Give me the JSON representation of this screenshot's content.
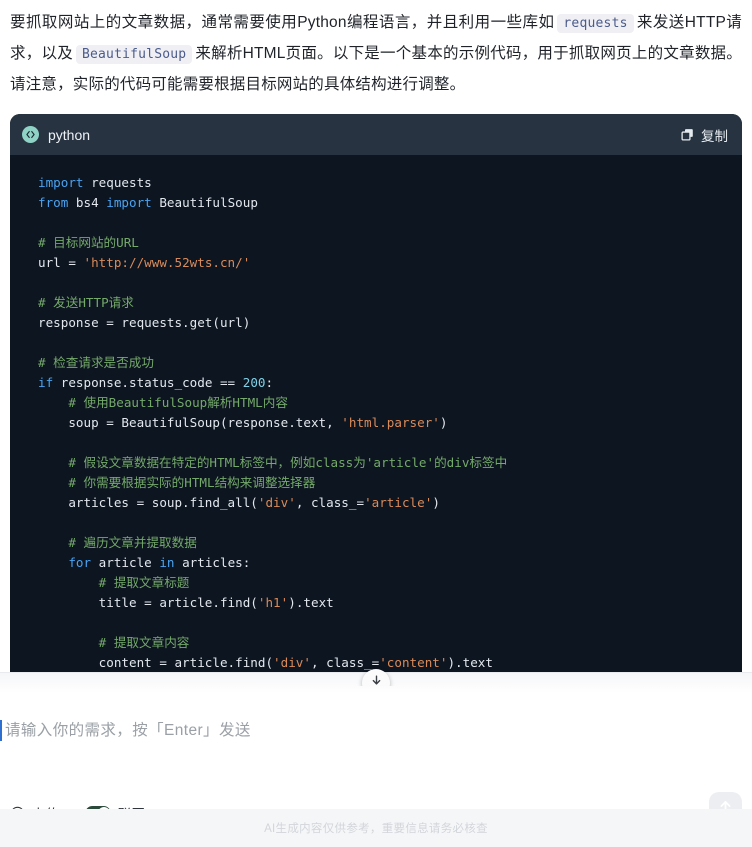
{
  "message": {
    "paragraph_parts": [
      {
        "type": "text",
        "value": "要抓取网站上的文章数据，通常需要使用Python编程语言，并且利用一些库如"
      },
      {
        "type": "code",
        "value": "requests"
      },
      {
        "type": "text",
        "value": "来发送HTTP请求，以及"
      },
      {
        "type": "code",
        "value": "BeautifulSoup"
      },
      {
        "type": "text",
        "value": "来解析HTML页面。以下是一个基本的示例代码，用于抓取网页上的文章数据。请注意，实际的代码可能需要根据目标网站的具体结构进行调整。"
      }
    ],
    "text_1": "要抓取网站上的文章数据，通常需要使用Python编程语言，并且利用一些库如",
    "code_1": "requests",
    "text_2": "来发送HTTP请求，以及",
    "code_2": "BeautifulSoup",
    "text_3": "来解析HTML页面。以下是一个基本的示例代码，用于抓取网页上的文章数据。请注意，实际的代码可能需要根据目标网站的具体结构进行调整。"
  },
  "code_block": {
    "language": "python",
    "language_icon": "code-brackets-icon",
    "copy_label": "复制",
    "copy_icon": "copy-icon",
    "lines": [
      {
        "tokens": [
          {
            "t": "kw",
            "v": "import"
          },
          {
            "t": "pl",
            "v": " requests"
          }
        ]
      },
      {
        "tokens": [
          {
            "t": "kw",
            "v": "from"
          },
          {
            "t": "pl",
            "v": " bs4 "
          },
          {
            "t": "kw",
            "v": "import"
          },
          {
            "t": "pl",
            "v": " BeautifulSoup"
          }
        ]
      },
      {
        "tokens": []
      },
      {
        "tokens": [
          {
            "t": "cm",
            "v": "# 目标网站的URL"
          }
        ]
      },
      {
        "tokens": [
          {
            "t": "pl",
            "v": "url = "
          },
          {
            "t": "str",
            "v": "'http://www.52wts.cn/'"
          }
        ]
      },
      {
        "tokens": []
      },
      {
        "tokens": [
          {
            "t": "cm",
            "v": "# 发送HTTP请求"
          }
        ]
      },
      {
        "tokens": [
          {
            "t": "pl",
            "v": "response = requests.get(url)"
          }
        ]
      },
      {
        "tokens": []
      },
      {
        "tokens": [
          {
            "t": "cm",
            "v": "# 检查请求是否成功"
          }
        ]
      },
      {
        "tokens": [
          {
            "t": "kw",
            "v": "if"
          },
          {
            "t": "pl",
            "v": " response.status_code == "
          },
          {
            "t": "num",
            "v": "200"
          },
          {
            "t": "pl",
            "v": ":"
          }
        ]
      },
      {
        "tokens": [
          {
            "t": "cm",
            "v": "    # 使用BeautifulSoup解析HTML内容"
          }
        ]
      },
      {
        "tokens": [
          {
            "t": "pl",
            "v": "    soup = BeautifulSoup(response.text, "
          },
          {
            "t": "str",
            "v": "'html.parser'"
          },
          {
            "t": "pl",
            "v": ")"
          }
        ]
      },
      {
        "tokens": []
      },
      {
        "tokens": [
          {
            "t": "cm",
            "v": "    # 假设文章数据在特定的HTML标签中，例如class为'article'的div标签中"
          }
        ]
      },
      {
        "tokens": [
          {
            "t": "cm",
            "v": "    # 你需要根据实际的HTML结构来调整选择器"
          }
        ]
      },
      {
        "tokens": [
          {
            "t": "pl",
            "v": "    articles = soup.find_all("
          },
          {
            "t": "str",
            "v": "'div'"
          },
          {
            "t": "pl",
            "v": ", class_="
          },
          {
            "t": "str",
            "v": "'article'"
          },
          {
            "t": "pl",
            "v": ")"
          }
        ]
      },
      {
        "tokens": []
      },
      {
        "tokens": [
          {
            "t": "cm",
            "v": "    # 遍历文章并提取数据"
          }
        ]
      },
      {
        "tokens": [
          {
            "t": "kw",
            "v": "    for"
          },
          {
            "t": "pl",
            "v": " article "
          },
          {
            "t": "kw",
            "v": "in"
          },
          {
            "t": "pl",
            "v": " articles:"
          }
        ]
      },
      {
        "tokens": [
          {
            "t": "cm",
            "v": "        # 提取文章标题"
          }
        ]
      },
      {
        "tokens": [
          {
            "t": "pl",
            "v": "        title = article.find("
          },
          {
            "t": "str",
            "v": "'h1'"
          },
          {
            "t": "pl",
            "v": ").text"
          }
        ]
      },
      {
        "tokens": []
      },
      {
        "tokens": [
          {
            "t": "cm",
            "v": "        # 提取文章内容"
          }
        ]
      },
      {
        "tokens": [
          {
            "t": "pl",
            "v": "        content = article.find("
          },
          {
            "t": "str",
            "v": "'div'"
          },
          {
            "t": "pl",
            "v": ", class_="
          },
          {
            "t": "str",
            "v": "'content'"
          },
          {
            "t": "pl",
            "v": ").text"
          }
        ]
      }
    ]
  },
  "scroll_down_icon": "arrow-down-icon",
  "composer": {
    "placeholder": "请输入你的需求，按「Enter」发送",
    "value": "",
    "upload_label": "上传",
    "upload_icon": "plus-circle-icon",
    "network_label": "联网",
    "network_enabled": true,
    "send_icon": "arrow-up-icon"
  },
  "footer": {
    "disclaimer": "AI生成内容仅供参考，重要信息请务必核查"
  },
  "colors": {
    "code_header_bg": "#273340",
    "code_body_bg": "#0d1520",
    "accent_teal": "#8fd2c6",
    "keyword": "#4aa3f0",
    "comment": "#74a96a",
    "string": "#d98b5a",
    "number": "#7fd1e8",
    "toggle_on": "#2b4a3b",
    "footer_text": "#d2d5da"
  }
}
